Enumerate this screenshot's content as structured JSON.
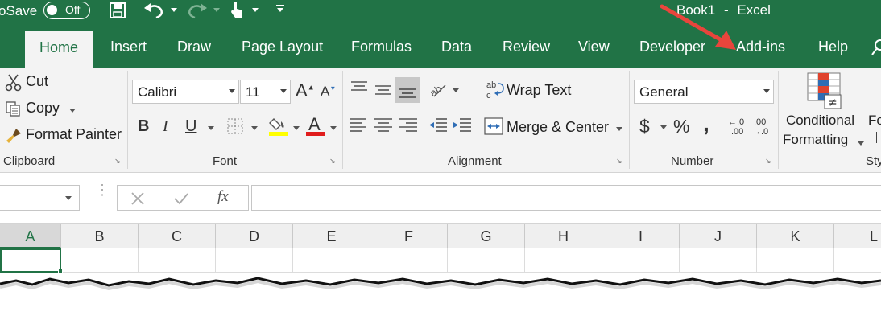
{
  "title_bar": {
    "autosave_label": "oSave",
    "autosave_toggle": "Off",
    "doc_title": "Book1",
    "title_separator": "-",
    "app_name": "Excel"
  },
  "tabs": [
    {
      "label": "Home",
      "active": true
    },
    {
      "label": "Insert"
    },
    {
      "label": "Draw"
    },
    {
      "label": "Page Layout"
    },
    {
      "label": "Formulas"
    },
    {
      "label": "Data"
    },
    {
      "label": "Review"
    },
    {
      "label": "View"
    },
    {
      "label": "Developer"
    },
    {
      "label": "Add-ins"
    },
    {
      "label": "Help"
    }
  ],
  "ribbon": {
    "clipboard": {
      "cut_label": "Cut",
      "copy_label": "Copy",
      "format_painter_label": "Format Painter",
      "group_label": "Clipboard"
    },
    "font": {
      "font_name": "Calibri",
      "font_size": "11",
      "bold": "B",
      "italic": "I",
      "underline": "U",
      "grow": "A",
      "shrink": "A",
      "font_color_letter": "A",
      "group_label": "Font"
    },
    "alignment": {
      "wrap_text_label": "Wrap Text",
      "merge_center_label": "Merge & Center",
      "group_label": "Alignment"
    },
    "number": {
      "format_value": "General",
      "currency": "$",
      "percent": "%",
      "comma": ",",
      "inc_decimal_top": "←.0",
      "inc_decimal_bottom": ".00",
      "dec_decimal_top": ".00",
      "dec_decimal_bottom": "→.0",
      "group_label": "Number"
    },
    "styles": {
      "conditional_line1": "Conditional",
      "conditional_line2": "Formatting",
      "format_as_table_partial": "Fo",
      "group_label_partial": "Sty"
    }
  },
  "formula_bar": {
    "name_box_value": "",
    "fx_label": "fx",
    "formula_value": ""
  },
  "grid": {
    "columns": [
      "A",
      "B",
      "C",
      "D",
      "E",
      "F",
      "G",
      "H",
      "I",
      "J",
      "K",
      "L"
    ],
    "selected_column": "A"
  },
  "colors": {
    "excel_green": "#217346",
    "annotation_arrow": "#e8453c"
  }
}
